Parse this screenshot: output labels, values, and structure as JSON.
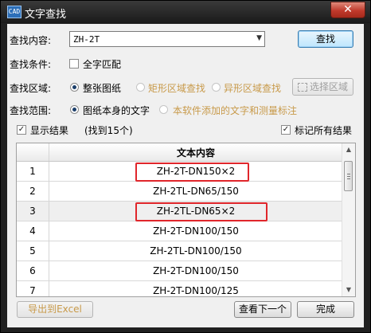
{
  "window": {
    "title": "文字查找",
    "close_label": "✕",
    "app_icon_label": "CAD"
  },
  "search": {
    "label": "查找内容:",
    "value": "ZH-2T",
    "button": "查找"
  },
  "conditions": {
    "label": "查找条件:",
    "whole_match": {
      "label": "全字匹配",
      "checked": false
    }
  },
  "area": {
    "label": "查找区域:",
    "options": [
      {
        "label": "整张图纸",
        "selected": true,
        "enabled": true
      },
      {
        "label": "矩形区域查找",
        "selected": false,
        "enabled": false
      },
      {
        "label": "异形区域查找",
        "selected": false,
        "enabled": false
      }
    ],
    "select_area_button": "选择区域"
  },
  "scope": {
    "label": "查找范围:",
    "options": [
      {
        "label": "图纸本身的文字",
        "selected": true,
        "enabled": true
      },
      {
        "label": "本软件添加的文字和测量标注",
        "selected": false,
        "enabled": false
      }
    ]
  },
  "results_bar": {
    "show_results": {
      "label": "显示结果",
      "checked": true
    },
    "found_text": "(找到15个)",
    "mark_all": {
      "label": "标记所有结果",
      "checked": true
    }
  },
  "table": {
    "header": "文本内容",
    "rows": [
      {
        "num": "1",
        "text": "ZH-2T-DN150×2",
        "highlighted": true
      },
      {
        "num": "2",
        "text": "ZH-2TL-DN65/150",
        "highlighted": false
      },
      {
        "num": "3",
        "text": "ZH-2TL-DN65×2",
        "highlighted": true
      },
      {
        "num": "4",
        "text": "ZH-2T-DN100/150",
        "highlighted": false
      },
      {
        "num": "5",
        "text": "ZH-2TL-DN100/150",
        "highlighted": false
      },
      {
        "num": "6",
        "text": "ZH-2T-DN100/150",
        "highlighted": false
      },
      {
        "num": "7",
        "text": "ZH-2T-DN100/125",
        "highlighted": false
      }
    ]
  },
  "footer": {
    "export": "导出到Excel",
    "next": "查看下一个",
    "done": "完成"
  },
  "colors": {
    "highlight": "#e0262b",
    "disabled_text": "#c89a4a",
    "selected_row": "#efefef"
  }
}
